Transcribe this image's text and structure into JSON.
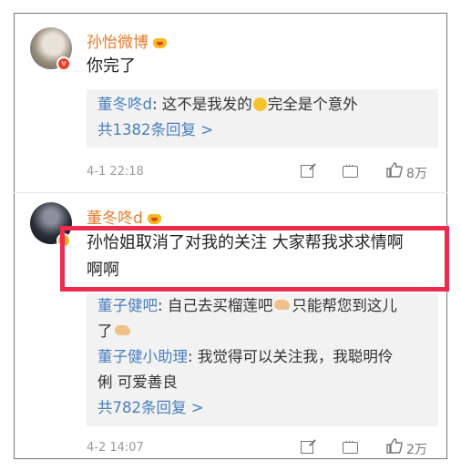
{
  "comments": [
    {
      "username": "孙怡微博",
      "text": "你完了",
      "replies": [
        {
          "name": "董冬咚d",
          "sep": ": ",
          "text_before": "这不是我发的",
          "text_after": "完全是个意外"
        }
      ],
      "more_replies": "共1382条回复 >",
      "timestamp": "4-1 22:18",
      "like_count": "8万"
    },
    {
      "username": "董冬咚d",
      "text_line1": "孙怡姐取消了对我的关注 大家帮我求求情啊",
      "text_line2": "啊啊",
      "replies": [
        {
          "name": "董子健吧",
          "sep": ": ",
          "text_before": "自己去买榴莲吧",
          "text_mid": "只能帮您到这儿",
          "text_line2": "了"
        },
        {
          "name": "董子健小助理",
          "sep": ": ",
          "text_line1": "我觉得可以关注我，我聪明伶",
          "text_line2": "俐 可爱善良"
        }
      ],
      "more_replies": "共782条回复 >",
      "timestamp": "4-2 14:07",
      "like_count": "2万"
    }
  ],
  "accent_color": "#e77b2d",
  "link_color": "#4a7fc0",
  "highlight_color": "#ee2a4d"
}
